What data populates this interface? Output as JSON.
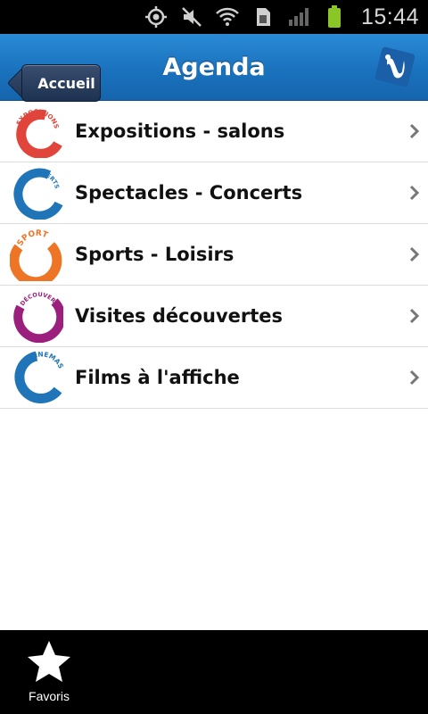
{
  "status_bar": {
    "time": "15:44",
    "icons": [
      "gps-icon",
      "mute-icon",
      "wifi-icon",
      "sim-icon",
      "signal-icon",
      "battery-icon"
    ]
  },
  "header": {
    "back_label": "Accueil",
    "title": "Agenda",
    "logo_icon": "app-logo-icon"
  },
  "list": {
    "items": [
      {
        "label": "Expositions - salons",
        "badge_text": "EXPOSITIONS",
        "color": "#e0443a"
      },
      {
        "label": "Spectacles - Concerts",
        "badge_text": "ET CONCERTS SPECTACLES",
        "color": "#1f75b8"
      },
      {
        "label": "Sports - Loisirs",
        "badge_text": "SPORT",
        "color": "#ee7526"
      },
      {
        "label": "Visites découvertes",
        "badge_text": "DÉCOUVERTES VISITES",
        "color": "#9b1f7c"
      },
      {
        "label": "Films à l'affiche",
        "badge_text": "CINEMAS",
        "color": "#1f75b8"
      }
    ]
  },
  "tabbar": {
    "favorites_label": "Favoris",
    "favorites_icon": "star-icon"
  },
  "colors": {
    "header_blue": "#1a72bd",
    "back_button": "#1d3150"
  }
}
